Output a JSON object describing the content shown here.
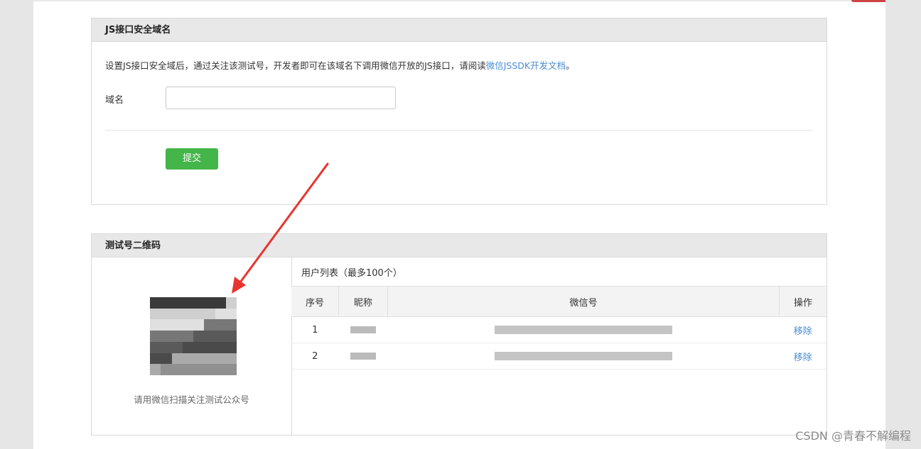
{
  "js_domain": {
    "title": "JS接口安全域名",
    "description": "设置JS接口安全域后，通过关注该测试号，开发者即可在该域名下调用微信开放的JS接口，请阅读",
    "doc_link": "微信JSSDK开发文档",
    "description_end": "。",
    "domain_label": "域名",
    "domain_value": "",
    "submit_label": "提交"
  },
  "qrcode": {
    "title": "测试号二维码",
    "caption": "请用微信扫描关注测试公众号"
  },
  "users": {
    "title": "用户列表（最多100个）",
    "columns": [
      "序号",
      "昵称",
      "微信号",
      "操作"
    ],
    "rows": [
      {
        "index": "1",
        "action": "移除"
      },
      {
        "index": "2",
        "action": "移除"
      }
    ]
  },
  "watermark": "CSDN @青春不解编程",
  "colors": {
    "accent": "#44b549",
    "link": "#4a8cd6",
    "annotation": "#e8342f"
  }
}
